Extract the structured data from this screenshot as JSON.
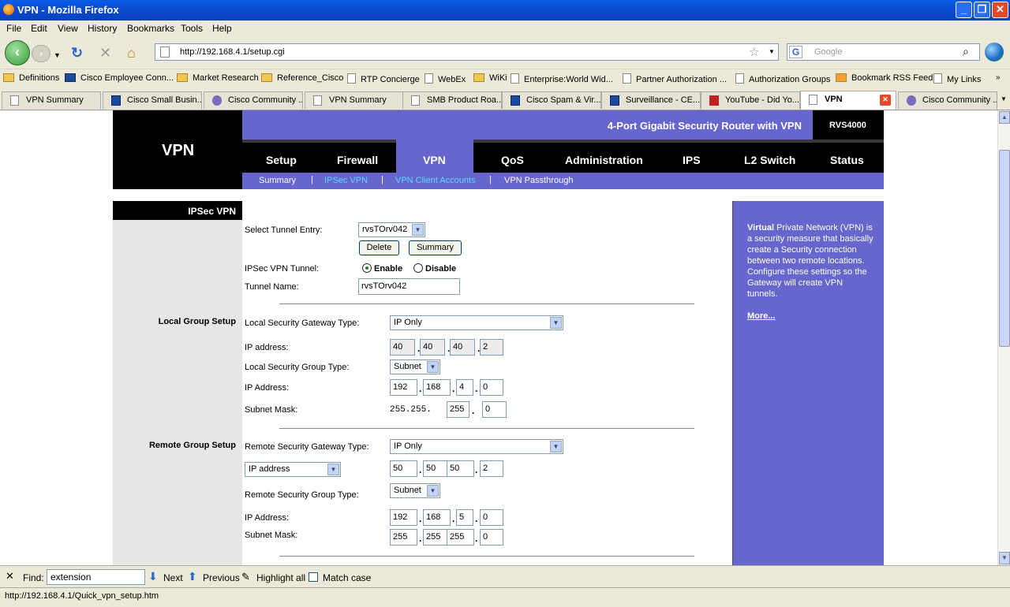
{
  "window": {
    "title": "VPN - Mozilla Firefox"
  },
  "menu": [
    "File",
    "Edit",
    "View",
    "History",
    "Bookmarks",
    "Tools",
    "Help"
  ],
  "nav": {
    "url": "http://192.168.4.1/setup.cgi",
    "search_placeholder": "Google"
  },
  "bookmarks": [
    "Definitions",
    "Cisco Employee Conn...",
    "Market Research",
    "Reference_Cisco",
    "RTP Concierge",
    "WebEx",
    "WiKi",
    "Enterprise:World Wid...",
    "Partner Authorization ...",
    "Authorization Groups",
    "Bookmark RSS Feed",
    "My Links"
  ],
  "tabs": [
    "VPN Summary",
    "Cisco Small Busin...",
    "Cisco Community ...",
    "VPN Summary",
    "SMB Product Roa...",
    "Cisco Spam & Vir...",
    "Surveillance - CE...",
    "YouTube - Did Yo...",
    "VPN",
    "Cisco Community ..."
  ],
  "router": {
    "logo": "VPN",
    "product": "4-Port Gigabit Security Router with VPN",
    "model": "RVS4000",
    "main_tabs": [
      "Setup",
      "Firewall",
      "VPN",
      "QoS",
      "Administration",
      "IPS",
      "L2 Switch",
      "Status"
    ],
    "sub_tabs": [
      "Summary",
      "IPSec VPN",
      "VPN Client Accounts",
      "VPN Passthrough"
    ],
    "section_header": "IPSec VPN",
    "local_group": "Local Group Setup",
    "remote_group": "Remote Group Setup",
    "help_bold": "Virtual",
    "help_text": " Private Network (VPN) is a security measure that basically create a Security connection between two remote locations. Configure these settings so the Gateway will create VPN tunnels.",
    "more": "More...",
    "form": {
      "select_tunnel_label": "Select Tunnel Entry:",
      "tunnel_entry": "rvsTOrv042",
      "delete": "Delete",
      "summary": "Summary",
      "tunnel_label": "IPSec VPN Tunnel:",
      "enable": "Enable",
      "disable": "Disable",
      "tunnel_name_label": "Tunnel Name:",
      "tunnel_name": "rvsTOrv042",
      "local_gw_type_label": "Local Security Gateway Type:",
      "local_gw_type": "IP Only",
      "ip_label": "IP address:",
      "local_ip": [
        "40",
        "40",
        "40",
        "2"
      ],
      "local_group_type_label": "Local Security Group Type:",
      "local_group_type": "Subnet",
      "ip_addr_label": "IP Address:",
      "local_group_ip": [
        "192",
        "168",
        "4",
        "0"
      ],
      "subnet_label": "Subnet Mask:",
      "local_mask_fixed": "255.255.",
      "local_mask": [
        "255",
        "0"
      ],
      "remote_gw_type_label": "Remote Security Gateway Type:",
      "remote_gw_type": "IP Only",
      "remote_id_type": "IP address",
      "remote_ip": [
        "50",
        "50",
        "50",
        "2"
      ],
      "remote_group_type_label": "Remote Security Group Type:",
      "remote_group_type": "Subnet",
      "remote_group_ip": [
        "192",
        "168",
        "5",
        "0"
      ],
      "remote_mask": [
        "255",
        "255",
        "255",
        "0"
      ]
    }
  },
  "find": {
    "label": "Find:",
    "value": "extension",
    "next": "Next",
    "previous": "Previous",
    "highlight": "Highlight all",
    "match_case": "Match case"
  },
  "status": "http://192.168.4.1/Quick_vpn_setup.htm"
}
